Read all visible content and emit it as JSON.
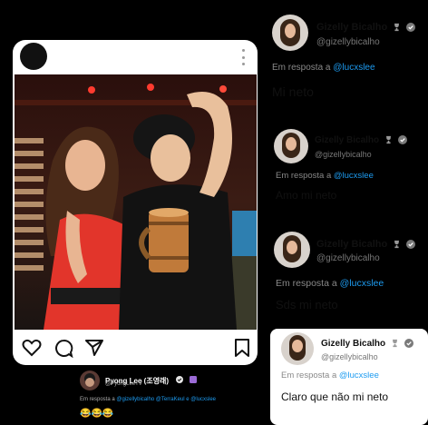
{
  "instagram_post": {
    "photo_alt": "Two people posing with a wooden mug"
  },
  "replies": [
    {
      "name": "Gizelly Bicalho",
      "handle": "@gizellybicalho",
      "reply_prefix": "Em resposta a",
      "reply_to": "@lucxslee",
      "text": "Mi neto"
    },
    {
      "name": "Gizelly Bicalho",
      "handle": "@gizellybicalho",
      "reply_prefix": "Em resposta a",
      "reply_to": "@lucxslee",
      "text": "Amo mi neto"
    },
    {
      "name": "Gizelly Bicalho",
      "handle": "@gizellybicalho",
      "reply_prefix": "Em resposta a",
      "reply_to": "@lucxslee",
      "text": "Sds mi neto"
    },
    {
      "name": "Gizelly Bicalho",
      "handle": "@gizellybicalho",
      "reply_prefix": "Em resposta a",
      "reply_to": "@lucxslee",
      "text": "Claro que não mi neto"
    }
  ],
  "pyong_tweet": {
    "name": "Pyong Lee (조영래)",
    "handle": "@PyongLeeTV",
    "reply_prefix": "Em resposta a",
    "reply_to": "@gizellybicalho @TerraKeul e @lucxslee",
    "emojis": "😂😂😂"
  },
  "colors": {
    "link": "#1d9bf0",
    "verified": "#7a7a7a",
    "background": "#000000"
  }
}
